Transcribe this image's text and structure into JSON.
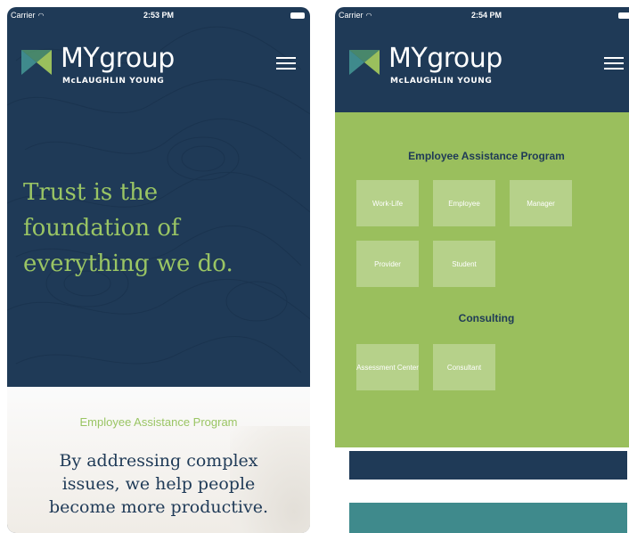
{
  "screens": [
    {
      "status": {
        "carrier": "Carrier",
        "time": "2:53 PM"
      },
      "brand": {
        "name": "MYgroup",
        "tagline": "McLAUGHLIN YOUNG"
      },
      "hero_lines": [
        "Trust is the",
        "foundation of",
        "everything we do."
      ],
      "section_label": "Employee Assistance Program",
      "body_lines": [
        "By addressing complex",
        "issues, we help people",
        "become more productive."
      ]
    },
    {
      "status": {
        "carrier": "Carrier",
        "time": "2:54 PM"
      },
      "brand": {
        "name": "MYgroup",
        "tagline": "McLAUGHLIN YOUNG"
      },
      "eap": {
        "title": "Employee Assistance Program",
        "tiles": [
          "Work-Life",
          "Employee",
          "Manager",
          "Provider",
          "Student"
        ]
      },
      "consulting": {
        "title": "Consulting",
        "tiles": [
          "Assessment Center",
          "Consultant"
        ]
      }
    }
  ],
  "colors": {
    "navy": "#1f3a57",
    "green": "#9abf5d",
    "accent_green": "#9ac564",
    "teal": "#3f8a8c"
  },
  "icons": {
    "logo": "mygroup-logo-icon",
    "menu": "hamburger-menu-icon",
    "wifi": "wifi-icon",
    "battery": "battery-icon"
  }
}
